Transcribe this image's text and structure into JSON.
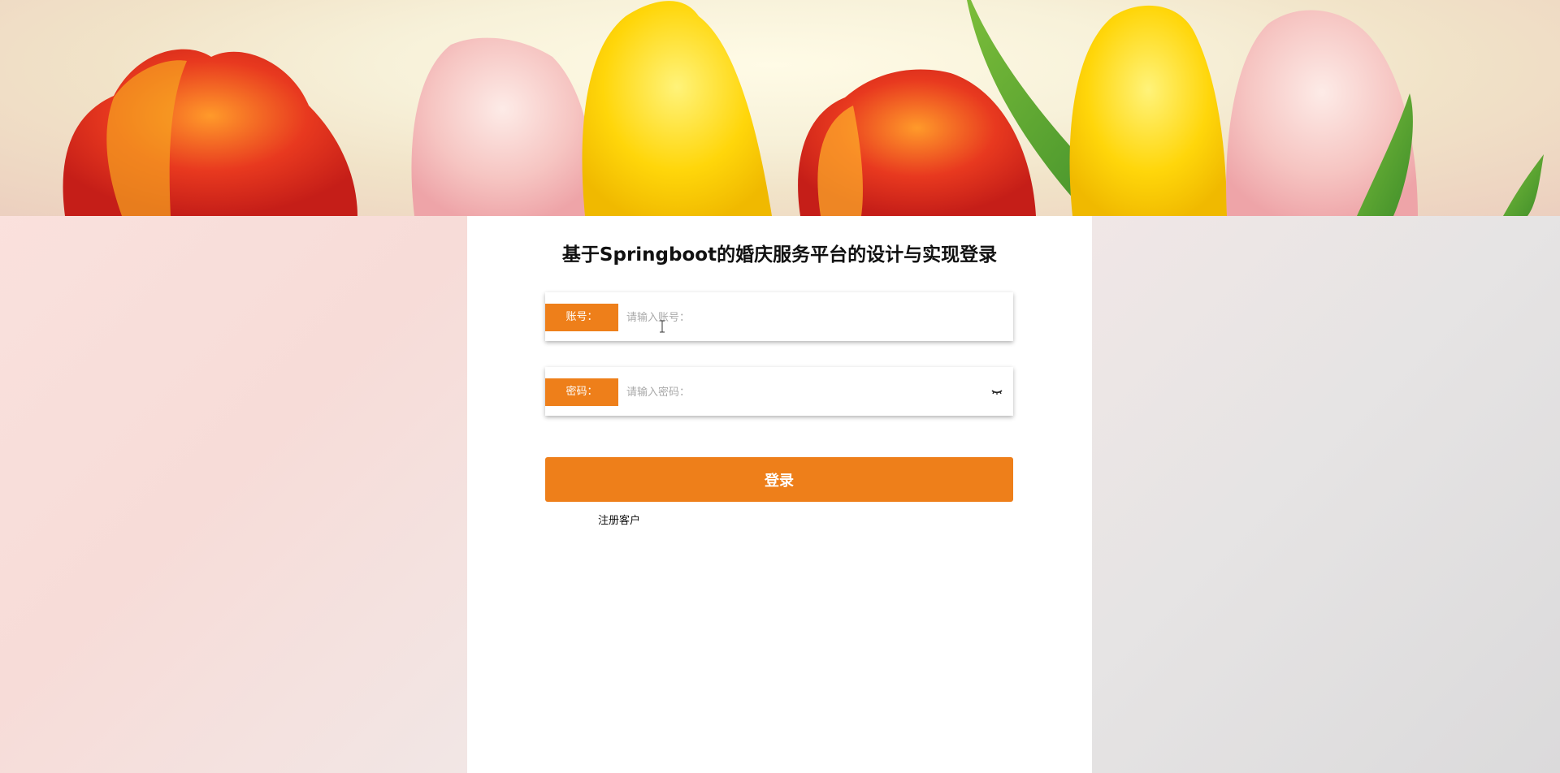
{
  "banner": {
    "image": "tulip-banner-image"
  },
  "login": {
    "title": "基于Springboot的婚庆服务平台的设计与实现登录",
    "account_label": "账号：",
    "account_placeholder": "请输入账号：",
    "account_value": "",
    "password_label": "密码：",
    "password_placeholder": "请输入密码：",
    "password_value": "",
    "password_toggle_icon": "eye-closed-icon",
    "submit_label": "登录",
    "register_link": "注册客户"
  },
  "colors": {
    "accent": "#ee7f1a",
    "panel": "#ffffff",
    "title_text": "#111111"
  }
}
